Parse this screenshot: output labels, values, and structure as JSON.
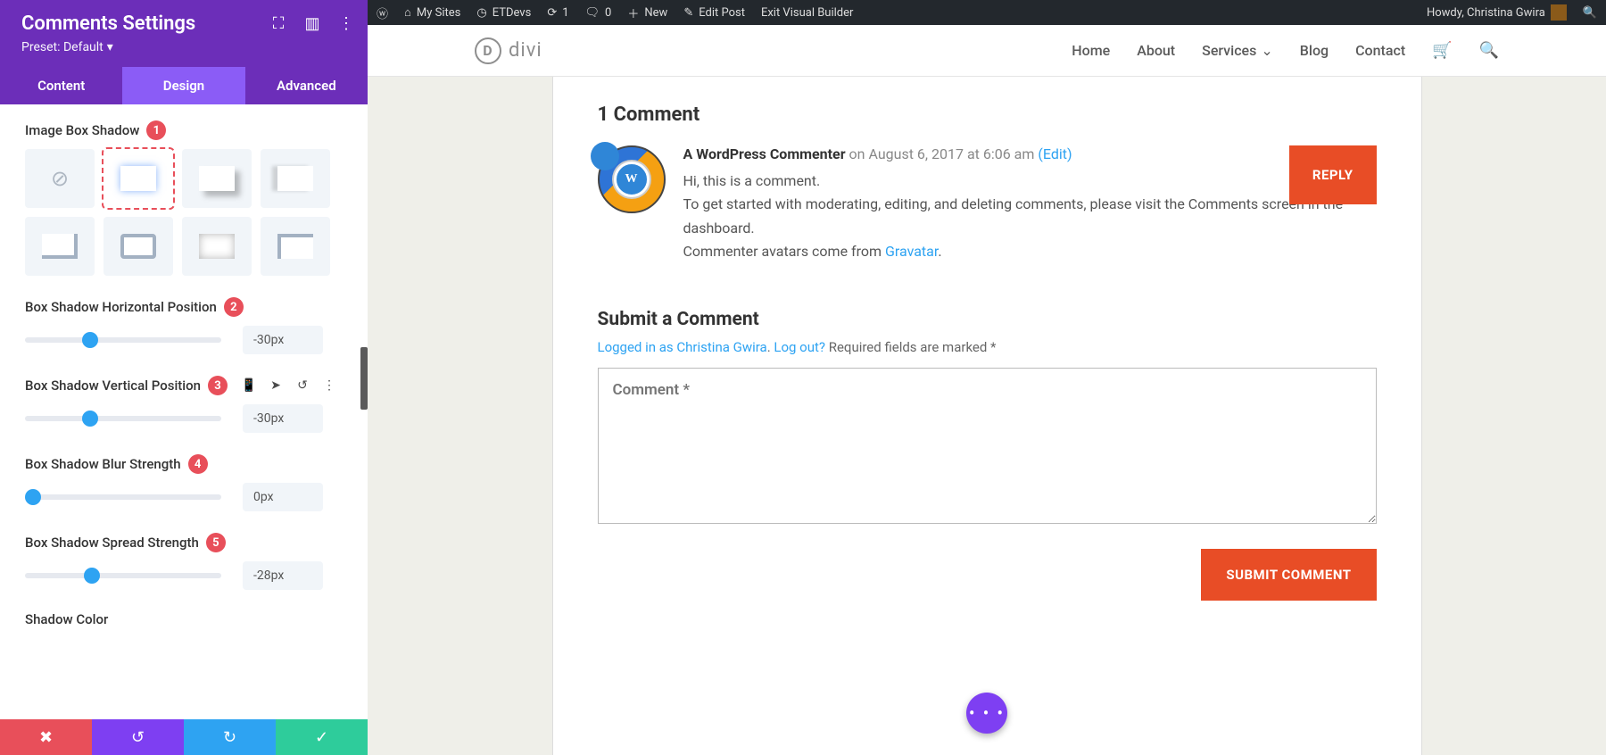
{
  "sidebar": {
    "title": "Comments Settings",
    "preset_label": "Preset: Default",
    "dropdown_glyph": "▾",
    "icons": {
      "expand": "⛶",
      "cols": "▥",
      "more": "⋮"
    },
    "tabs": {
      "content": "Content",
      "design": "Design",
      "advanced": "Advanced"
    },
    "labels": {
      "image_box_shadow": "Image Box Shadow",
      "h_pos": "Box Shadow Horizontal Position",
      "v_pos": "Box Shadow Vertical Position",
      "blur": "Box Shadow Blur Strength",
      "spread": "Box Shadow Spread Strength",
      "shadow_color": "Shadow Color"
    },
    "badges": {
      "shadow": "1",
      "hpos": "2",
      "vpos": "3",
      "blur": "4",
      "spread": "5"
    },
    "row_icons": {
      "phone": "📱",
      "cursor": "➤",
      "reset": "↺",
      "more": "⋮"
    },
    "values": {
      "hpos": "-30px",
      "vpos": "-30px",
      "blur": "0px",
      "spread": "-28px"
    },
    "footer_icons": {
      "cancel": "✖",
      "undo": "↺",
      "redo": "↻",
      "save": "✓"
    }
  },
  "wp": {
    "logo": "ⓦ",
    "my_sites": "My Sites",
    "etdevs": "ETDevs",
    "updates": "1",
    "comments": "0",
    "new": "New",
    "edit_post": "Edit Post",
    "exit": "Exit Visual Builder",
    "howdy": "Howdy, Christina Gwira"
  },
  "site": {
    "logo_letter": "D",
    "logo_text": "divi",
    "nav": {
      "home": "Home",
      "about": "About",
      "services": "Services",
      "blog": "Blog",
      "contact": "Contact"
    },
    "dd_glyph": "⌄",
    "cart_glyph": "🛒",
    "search_glyph": "🔍"
  },
  "comments": {
    "heading": "1 Comment",
    "author": "A WordPress Commenter",
    "on": " on ",
    "date": "August 6, 2017 at 6:06 am",
    "edit": "(Edit)",
    "avatar_letter": "W",
    "body1": "Hi, this is a comment.",
    "body2_a": "To get started with moderating, editing, and deleting comments, please visit the Comments screen in the dashboard.",
    "body3_a": "Commenter avatars come from ",
    "body3_link": "Gravatar",
    "body3_b": ".",
    "reply": "REPLY"
  },
  "form": {
    "heading": "Submit a Comment",
    "logged_in": "Logged in as Christina Gwira",
    "logout": "Log out?",
    "sep": ". ",
    "required": " Required fields are marked *",
    "placeholder": "Comment *",
    "submit": "SUBMIT COMMENT"
  },
  "fab": "• • •"
}
